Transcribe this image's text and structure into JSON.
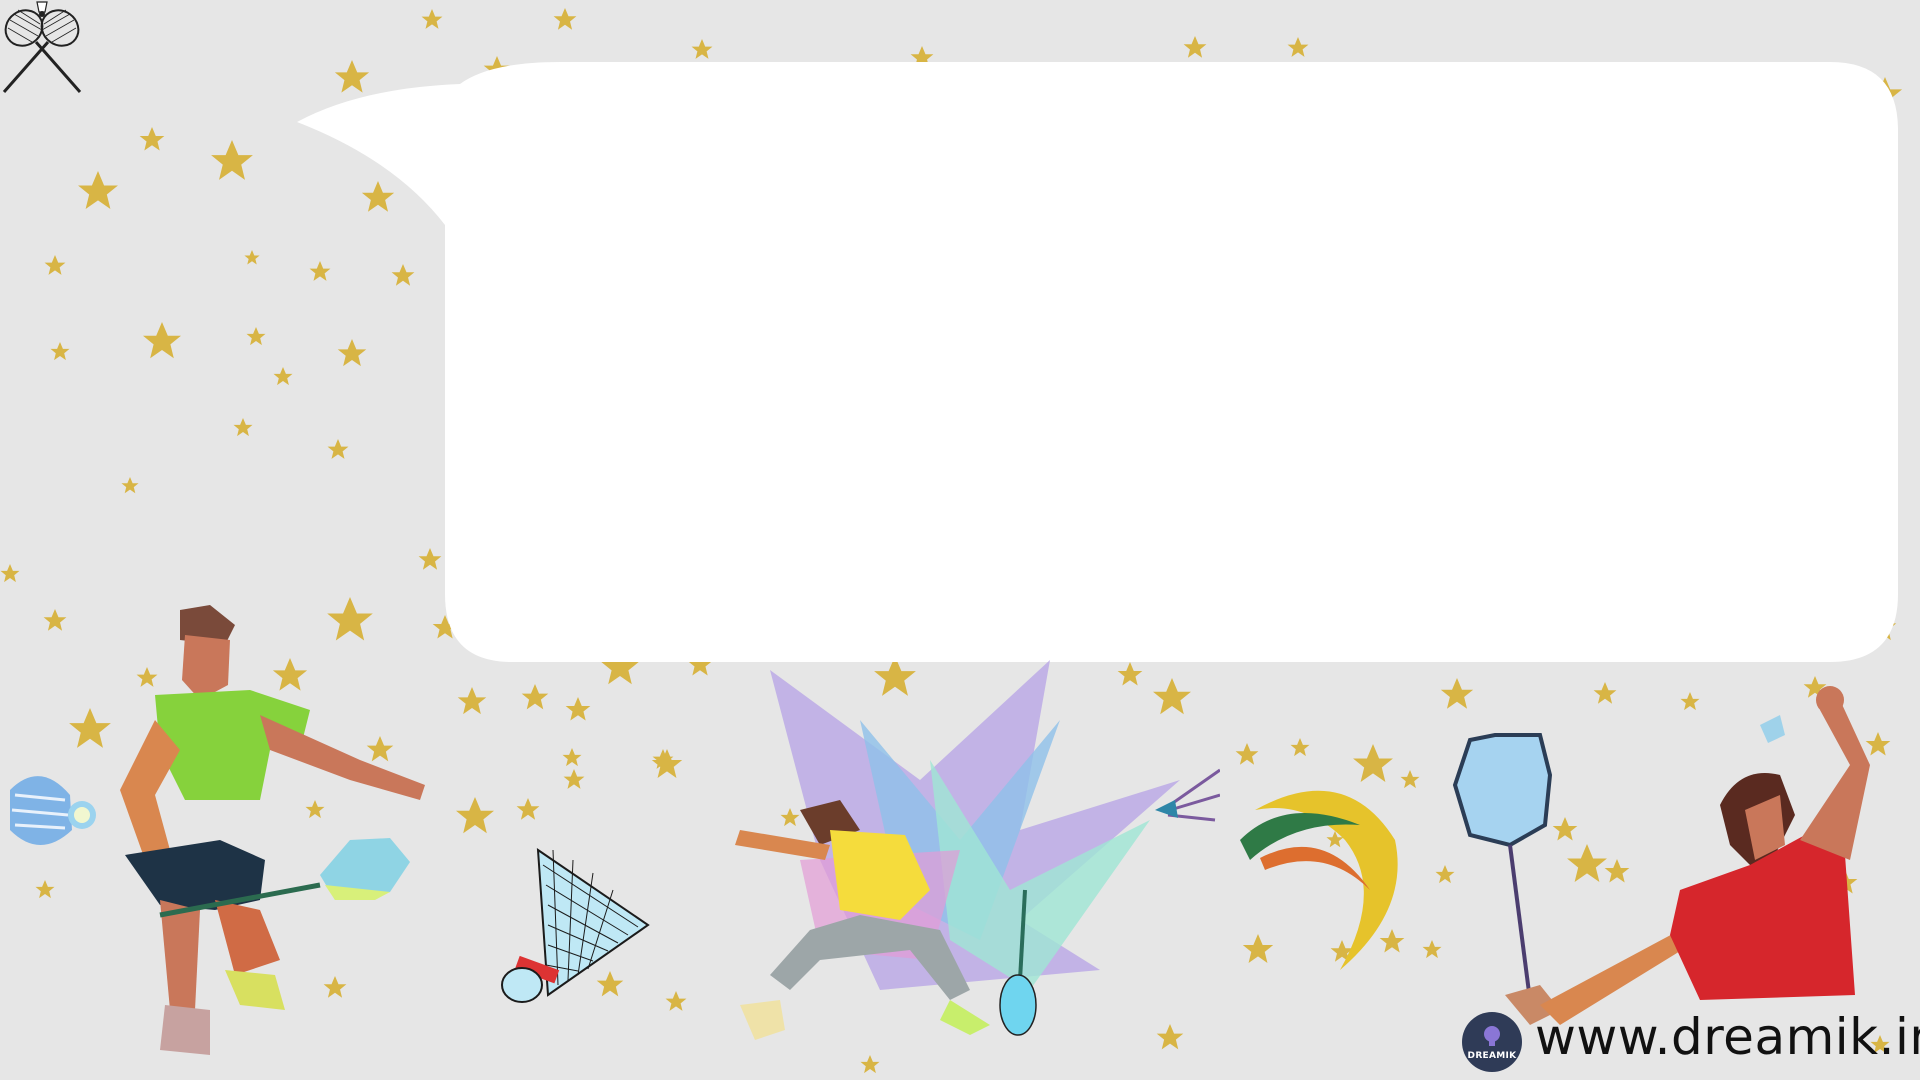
{
  "footer": {
    "website": "www.dreamik.in",
    "logo_text": "DREAMIK"
  },
  "colors": {
    "background": "#e6e6e6",
    "bubble": "#ffffff",
    "star": "#d8b545",
    "logo_badge": "#2f3b57"
  },
  "icons": [
    "crossed-rackets-icon",
    "shuttlecock-icon",
    "player-art",
    "star-icon"
  ]
}
